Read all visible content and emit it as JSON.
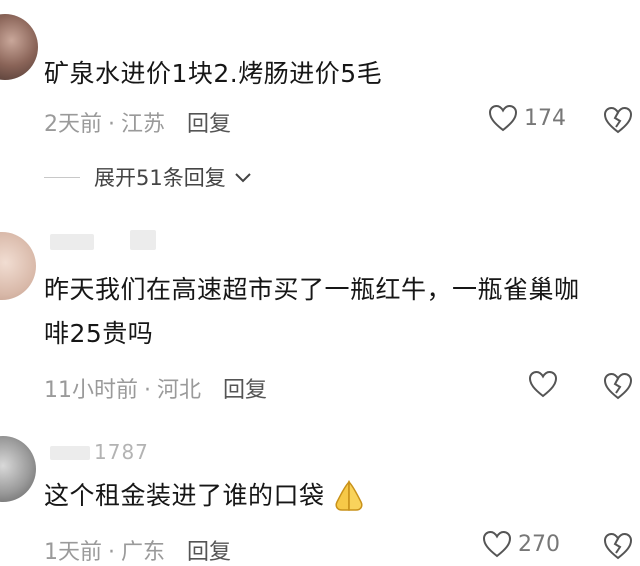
{
  "comments": [
    {
      "username": "",
      "text": "矿泉水进价1块2.烤肠进价5毛",
      "time": "2天前",
      "location": "江苏",
      "reply_label": "回复",
      "likes": "174",
      "replies_label": "展开51条回复"
    },
    {
      "username": "",
      "text_line1": "昨天我们在高速超市买了一瓶红牛，一瓶雀巢咖",
      "text_line2": "啡25贵吗",
      "time": "11小时前",
      "location": "河北",
      "reply_label": "回复",
      "likes": ""
    },
    {
      "username": "1787",
      "text": "这个租金装进了谁的口袋",
      "time": "1天前",
      "location": "广东",
      "reply_label": "回复",
      "likes": "270",
      "emoji": "pray-hands-icon"
    }
  ],
  "separator": "·",
  "colors": {
    "text": "#161616",
    "meta": "#9a9a9a",
    "icon": "#555555"
  }
}
